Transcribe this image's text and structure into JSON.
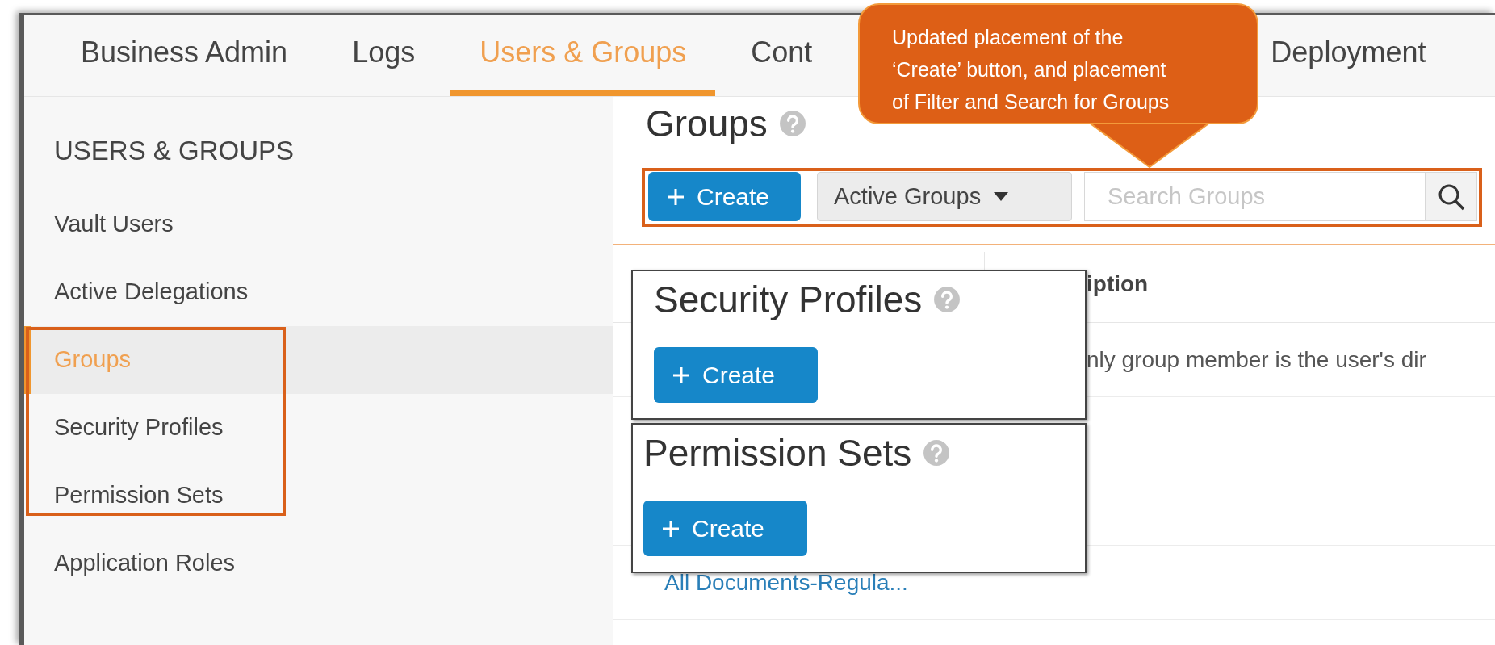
{
  "tabs": [
    {
      "label": "Business Admin",
      "selected": false
    },
    {
      "label": "Logs",
      "selected": false
    },
    {
      "label": "Users & Groups",
      "selected": true
    },
    {
      "label": "Cont",
      "selected": false
    },
    {
      "label": "Deployment",
      "selected": false
    }
  ],
  "sidebar": {
    "heading": "USERS & GROUPS",
    "items": [
      {
        "label": "Vault Users",
        "selected": false
      },
      {
        "label": "Active Delegations",
        "selected": false
      },
      {
        "label": "Groups",
        "selected": true
      },
      {
        "label": "Security Profiles",
        "selected": false
      },
      {
        "label": "Permission Sets",
        "selected": false
      },
      {
        "label": "Application Roles",
        "selected": false
      }
    ]
  },
  "groups_page": {
    "title": "Groups",
    "create_button": "Create",
    "filter": "Active Groups",
    "search": {
      "placeholder": "Search Groups"
    }
  },
  "table": {
    "header": {
      "column_2": "iption"
    },
    "rows": [
      {
        "column_2": "nly group member is the user's dir"
      },
      {},
      {},
      {
        "column_1": "All Documents-Regula..."
      }
    ]
  },
  "overlays": [
    {
      "title": "Security Profiles",
      "create_button": "Create"
    },
    {
      "title": "Permission Sets",
      "create_button": "Create"
    }
  ],
  "callout": {
    "lines": [
      "Updated placement of the",
      "‘Create’ button, and placement",
      "of Filter and Search for Groups"
    ]
  }
}
